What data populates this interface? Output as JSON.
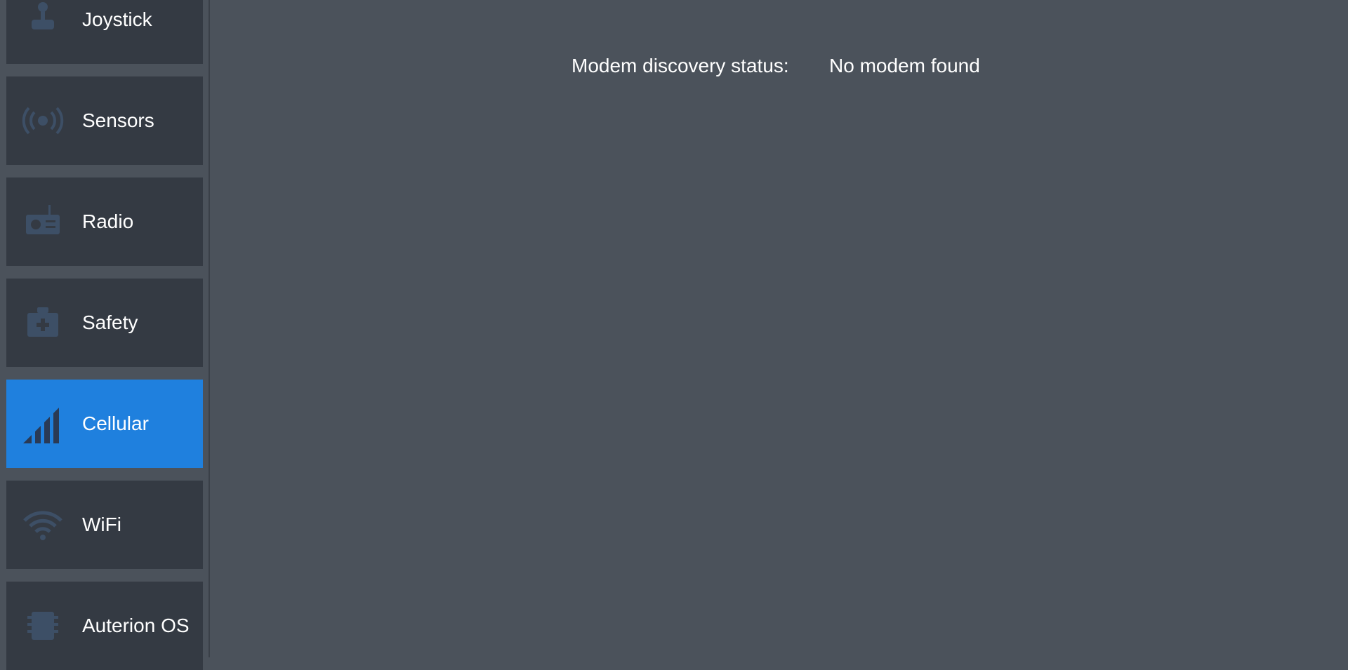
{
  "sidebar": {
    "items": [
      {
        "label": "Joystick",
        "icon": "joystick-icon",
        "active": false
      },
      {
        "label": "Sensors",
        "icon": "sensors-icon",
        "active": false
      },
      {
        "label": "Radio",
        "icon": "radio-icon",
        "active": false
      },
      {
        "label": "Safety",
        "icon": "safety-icon",
        "active": false
      },
      {
        "label": "Cellular",
        "icon": "cellular-signal-icon",
        "active": true
      },
      {
        "label": "WiFi",
        "icon": "wifi-icon",
        "active": false
      },
      {
        "label": "Auterion OS",
        "icon": "auterion-os-icon",
        "active": false
      }
    ]
  },
  "main": {
    "modem_status_label": "Modem discovery status:",
    "modem_status_value": "No modem found"
  },
  "colors": {
    "background": "#4b525b",
    "item_background": "#343a43",
    "active_item": "#1f80de",
    "icon_dim": "#3d4f66",
    "icon_active": "#2a3a55",
    "text": "#ffffff"
  }
}
